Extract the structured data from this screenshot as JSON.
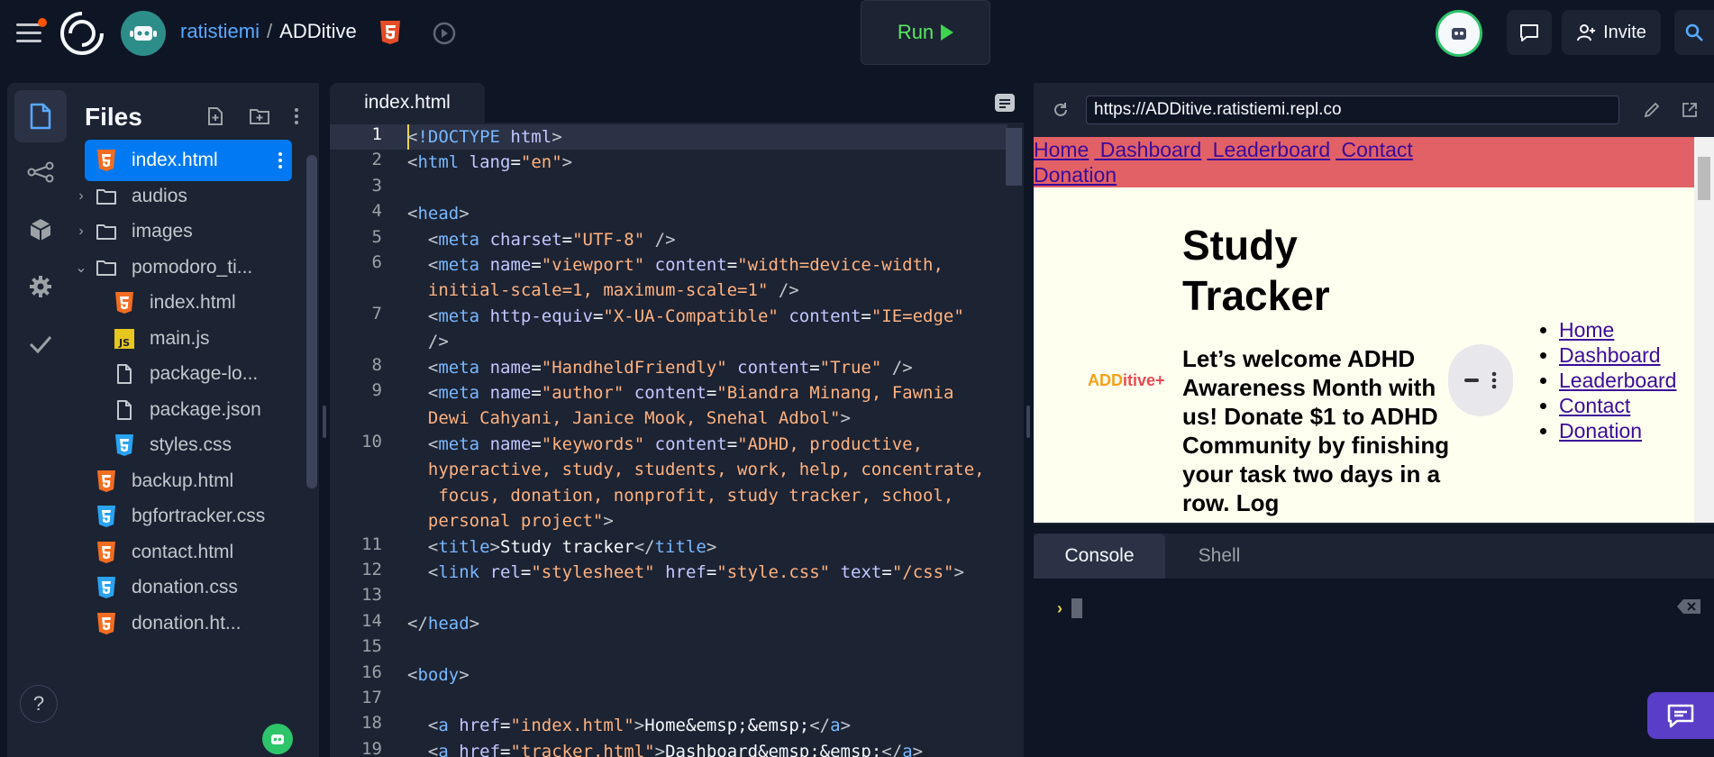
{
  "app": {
    "owner": "ratistiemi",
    "separator": "/",
    "project": "ADDitive",
    "run_label": "Run",
    "invite_label": "Invite"
  },
  "files": {
    "title": "Files",
    "items": [
      {
        "name": "index.html",
        "type": "html",
        "indent": 0,
        "active": true
      },
      {
        "name": "audios",
        "type": "folder",
        "indent": 0,
        "chevron": "›"
      },
      {
        "name": "images",
        "type": "folder",
        "indent": 0,
        "chevron": "›"
      },
      {
        "name": "pomodoro_ti...",
        "type": "folder",
        "indent": 0,
        "chevron": "⌄"
      },
      {
        "name": "index.html",
        "type": "html",
        "indent": 1
      },
      {
        "name": "main.js",
        "type": "js",
        "indent": 1
      },
      {
        "name": "package-lo...",
        "type": "file",
        "indent": 1
      },
      {
        "name": "package.json",
        "type": "file",
        "indent": 1
      },
      {
        "name": "styles.css",
        "type": "css",
        "indent": 1
      },
      {
        "name": "backup.html",
        "type": "html",
        "indent": 0
      },
      {
        "name": "bgfortracker.css",
        "type": "css",
        "indent": 0
      },
      {
        "name": "contact.html",
        "type": "html",
        "indent": 0
      },
      {
        "name": "donation.css",
        "type": "css",
        "indent": 0
      },
      {
        "name": "donation.ht...",
        "type": "html",
        "indent": 0
      }
    ]
  },
  "editor": {
    "tab": "index.html",
    "lines": [
      {
        "n": "1",
        "html": "<span class=\"p\">&lt;</span><span class=\"t\">!DOCTYPE</span> <span class=\"a\">html</span><span class=\"p\">&gt;</span>"
      },
      {
        "n": "2",
        "html": "<span class=\"p\">&lt;</span><span class=\"t\">html</span> <span class=\"a\">lang</span>=<span class=\"s\">\"en\"</span><span class=\"p\">&gt;</span>"
      },
      {
        "n": "3",
        "html": ""
      },
      {
        "n": "4",
        "html": "<span class=\"p\">&lt;</span><span class=\"t\">head</span><span class=\"p\">&gt;</span>"
      },
      {
        "n": "5",
        "html": "  <span class=\"p\">&lt;</span><span class=\"t\">meta</span> <span class=\"a\">charset</span>=<span class=\"s\">\"UTF-8\"</span> <span class=\"p\">/&gt;</span>"
      },
      {
        "n": "6",
        "html": "  <span class=\"p\">&lt;</span><span class=\"t\">meta</span> <span class=\"a\">name</span>=<span class=\"s\">\"viewport\"</span> <span class=\"a\">content</span>=<span class=\"s\">\"width=device-width,\n  initial-scale=1, maximum-scale=1\"</span> <span class=\"p\">/&gt;</span>"
      },
      {
        "n": "7",
        "html": "  <span class=\"p\">&lt;</span><span class=\"t\">meta</span> <span class=\"a\">http-equiv</span>=<span class=\"s\">\"X-UA-Compatible\"</span> <span class=\"a\">content</span>=<span class=\"s\">\"IE=edge\"</span>\n  <span class=\"p\">/&gt;</span>"
      },
      {
        "n": "8",
        "html": "  <span class=\"p\">&lt;</span><span class=\"t\">meta</span> <span class=\"a\">name</span>=<span class=\"s\">\"HandheldFriendly\"</span> <span class=\"a\">content</span>=<span class=\"s\">\"True\"</span> <span class=\"p\">/&gt;</span>"
      },
      {
        "n": "9",
        "html": "  <span class=\"p\">&lt;</span><span class=\"t\">meta</span> <span class=\"a\">name</span>=<span class=\"s\">\"author\"</span> <span class=\"a\">content</span>=<span class=\"s\">\"Biandra Minang, Fawnia\n  Dewi Cahyani, Janice Mook, Snehal Adbol\"</span><span class=\"p\">&gt;</span>"
      },
      {
        "n": "10",
        "html": "  <span class=\"p\">&lt;</span><span class=\"t\">meta</span> <span class=\"a\">name</span>=<span class=\"s\">\"keywords\"</span> <span class=\"a\">content</span>=<span class=\"s\">\"ADHD, productive,\n  hyperactive, study, students, work, help, concentrate,\n   focus, donation, nonprofit, study tracker, school,\n  personal project\"</span><span class=\"p\">&gt;</span>"
      },
      {
        "n": "11",
        "html": "  <span class=\"p\">&lt;</span><span class=\"t\">title</span><span class=\"p\">&gt;</span>Study tracker<span class=\"p\">&lt;/</span><span class=\"t\">title</span><span class=\"p\">&gt;</span>"
      },
      {
        "n": "12",
        "html": "  <span class=\"p\">&lt;</span><span class=\"t\">link</span> <span class=\"a\">rel</span>=<span class=\"s\">\"stylesheet\"</span> <span class=\"a\">href</span>=<span class=\"s\">\"style.css\"</span> <span class=\"a\">text</span>=<span class=\"s\">\"/css\"</span><span class=\"p\">&gt;</span>"
      },
      {
        "n": "13",
        "html": ""
      },
      {
        "n": "14",
        "html": "<span class=\"p\">&lt;/</span><span class=\"t\">head</span><span class=\"p\">&gt;</span>"
      },
      {
        "n": "15",
        "html": ""
      },
      {
        "n": "16",
        "html": "<span class=\"p\">&lt;</span><span class=\"t\">body</span><span class=\"p\">&gt;</span>"
      },
      {
        "n": "17",
        "html": ""
      },
      {
        "n": "18",
        "html": "  <span class=\"p\">&lt;</span><span class=\"t\">a</span> <span class=\"a\">href</span>=<span class=\"s\">\"index.html\"</span><span class=\"p\">&gt;</span>Home&amp;emsp;&amp;emsp;<span class=\"p\">&lt;/</span><span class=\"t\">a</span><span class=\"p\">&gt;</span>"
      },
      {
        "n": "19",
        "html": "  <span class=\"p\">&lt;</span><span class=\"t\">a</span> <span class=\"a\">href</span>=<span class=\"s\">\"tracker.html\"</span><span class=\"p\">&gt;</span>Dashboard&amp;emsp;&amp;emsp;<span class=\"p\">&lt;/</span><span class=\"t\">a</span><span class=\"p\">&gt;</span>"
      }
    ]
  },
  "webview": {
    "url": "https://ADDitive.ratistiemi.repl.co",
    "nav": [
      "Home",
      "Dashboard",
      "Leaderboard",
      "Contact",
      "Donation"
    ],
    "title": "Study Tracker",
    "logo_text": "ADDitive+",
    "welcome": "Let’s welcome ADHD Awareness Month with us! Donate $1 to ADHD Community by finishing your task two days in a row. Log",
    "side_links": [
      "Home",
      "Dashboard",
      "Leaderboard",
      "Contact",
      "Donation"
    ]
  },
  "console": {
    "tabs": [
      "Console",
      "Shell"
    ],
    "prompt": "›"
  }
}
